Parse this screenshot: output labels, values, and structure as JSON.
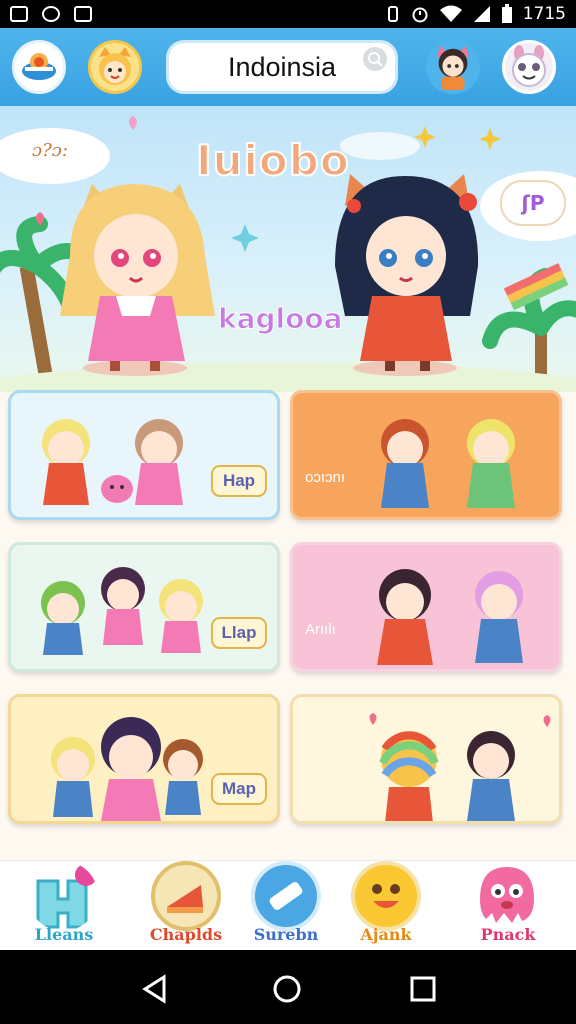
{
  "status_bar": {
    "time": "1715"
  },
  "app_bar": {
    "search_value": "Indoinsia"
  },
  "hero": {
    "title": "Iuiobo",
    "subtitle": "kaglooa",
    "note": "ɔ?ɔ:",
    "bubble": "ʃP"
  },
  "cards": [
    {
      "button": "Hap",
      "caption": ""
    },
    {
      "button": "",
      "caption": "oɔıɔnı"
    },
    {
      "button": "Llap",
      "caption": ""
    },
    {
      "button": "",
      "caption": "Arıılı"
    },
    {
      "button": "Map",
      "caption": ""
    },
    {
      "button": "",
      "caption": ""
    }
  ],
  "bottom_nav": [
    {
      "label": "Lleans",
      "color": "#2aa8c9",
      "icon": "letter-icon"
    },
    {
      "label": "Chaplds",
      "color": "#e04a2c",
      "icon": "cake-icon"
    },
    {
      "label": "Surebn",
      "color": "#3b6fd0",
      "icon": "eraser-icon"
    },
    {
      "label": "Ajank",
      "color": "#e58a12",
      "icon": "smiley-icon"
    },
    {
      "label": "Pnack",
      "color": "#e0386c",
      "icon": "blob-icon"
    }
  ],
  "colors": {
    "app_bar": "#3aa2e2",
    "card_blue": "#e8f6fc",
    "card_orange": "#f7a45c",
    "card_mint": "#eaf7f0",
    "card_pink": "#f8c3d7",
    "card_yellow": "#fff0c4",
    "card_cream": "#fff6de"
  }
}
